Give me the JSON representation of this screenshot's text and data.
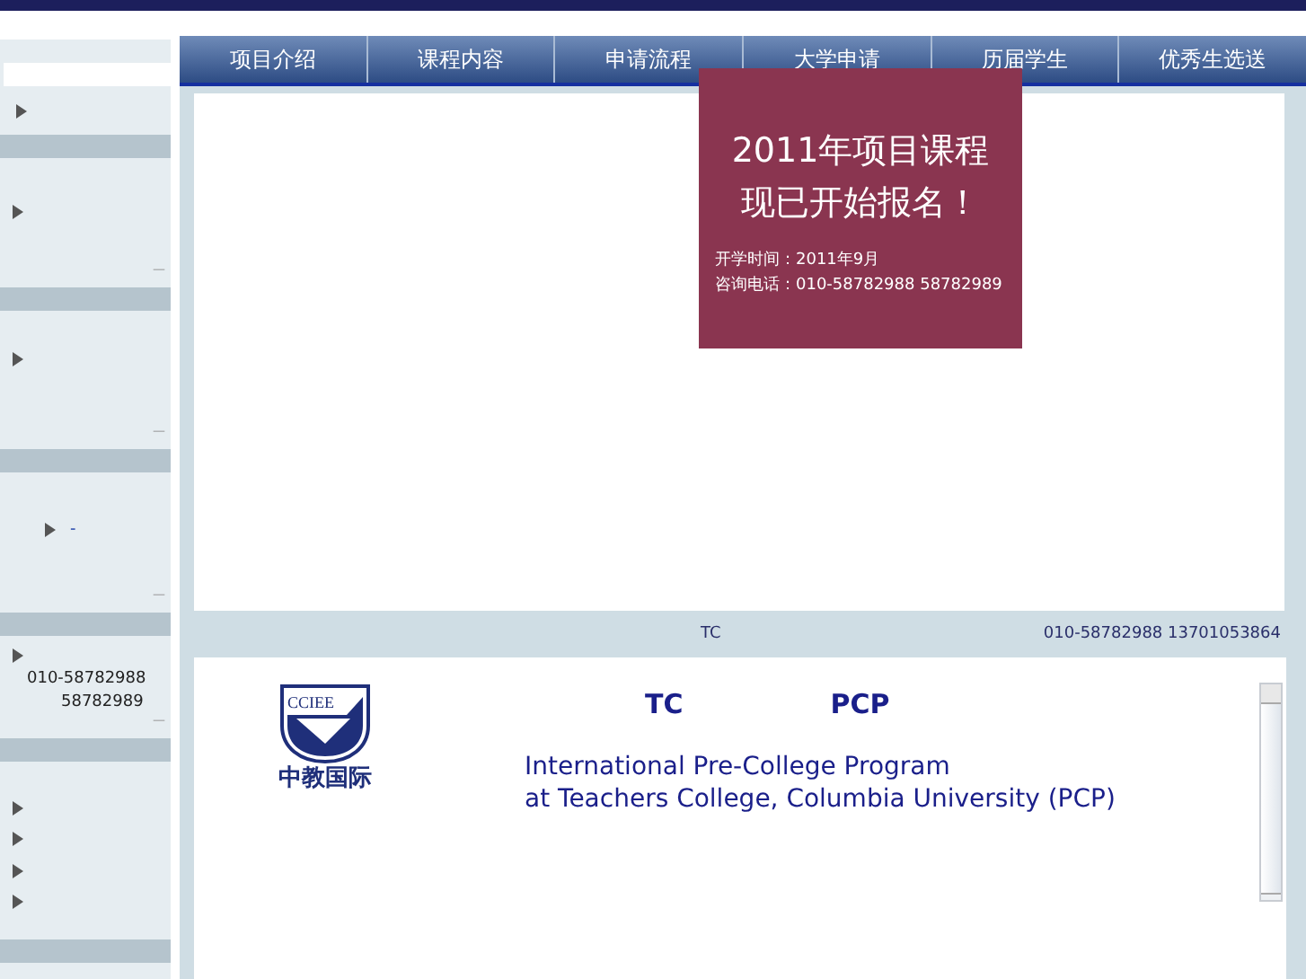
{
  "sidebar": {
    "sections": [
      {
        "items": [
          {
            "kind": "bullet"
          }
        ]
      },
      {
        "items": [
          {
            "kind": "bullet"
          }
        ],
        "more": "—"
      },
      {
        "items": [
          {
            "kind": "bullet"
          }
        ],
        "more": "—"
      },
      {
        "items": [
          {
            "kind": "sub",
            "text": "-"
          }
        ],
        "more": "—"
      },
      {
        "items": [
          {
            "kind": "bullet"
          },
          {
            "kind": "line",
            "text": "010-58782988"
          },
          {
            "kind": "line-right",
            "text": "58782989"
          }
        ],
        "more": "—"
      },
      {
        "items": [
          {
            "kind": "bullet"
          },
          {
            "kind": "bullet"
          },
          {
            "kind": "bullet"
          },
          {
            "kind": "bullet"
          }
        ]
      }
    ]
  },
  "nav": {
    "tabs": [
      {
        "label": "项目介绍"
      },
      {
        "label": "课程内容"
      },
      {
        "label": "申请流程"
      },
      {
        "label": "大学申请"
      },
      {
        "label": "历届学生"
      },
      {
        "label": "优秀生选送"
      }
    ]
  },
  "popup": {
    "headline": [
      "2011年项目课程",
      "现已开始报名！"
    ],
    "details": [
      "开学时间：2011年9月",
      "咨询电话：010-58782988  58782989"
    ]
  },
  "info_bar": {
    "center": "TC",
    "contact": "010-58782988 13701053864"
  },
  "intro": {
    "logo": {
      "mark": "CCIEE",
      "caption": "中教国际"
    },
    "headings": [
      "TC",
      "PCP"
    ],
    "text": [
      "International Pre-College Program",
      "at Teachers College, Columbia University (PCP)"
    ]
  }
}
